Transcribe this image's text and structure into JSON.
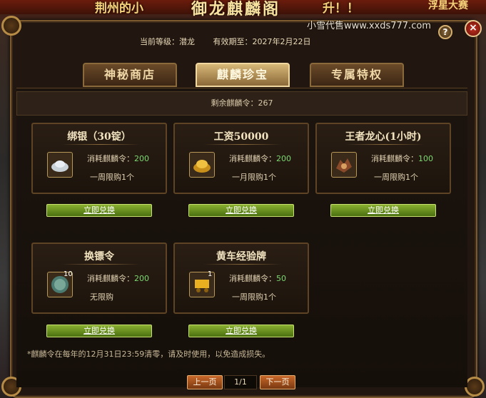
{
  "banner": {
    "left_text": "荆州的小",
    "center_text": "御龙麒麟阁",
    "right_text": "升！！",
    "far_right_text": "浮星大赛"
  },
  "watermark": "小雪代售www.xxds777.com",
  "controls": {
    "help_label": "?",
    "close_label": "×"
  },
  "header": {
    "level_label": "当前等级：潜龙",
    "expiry_label": "有效期至：2027年2月22日"
  },
  "tabs": [
    {
      "label": "神秘商店",
      "active": false
    },
    {
      "label": "麒麟珍宝",
      "active": true
    },
    {
      "label": "专属特权",
      "active": false
    }
  ],
  "remaining": "剩余麒麟令：267",
  "items": [
    {
      "title": "绑银（30锭）",
      "icon": "silver-ingot-icon",
      "cost_label": "消耗麒麟令：",
      "cost": "200",
      "limit": "一周限购1个",
      "count": "",
      "button": "立即兑换"
    },
    {
      "title": "工资50000",
      "icon": "gold-ingot-icon",
      "cost_label": "消耗麒麟令：",
      "cost": "200",
      "limit": "一月限购1个",
      "count": "",
      "button": "立即兑换"
    },
    {
      "title": "王者龙心(1小时)",
      "icon": "dragon-heart-icon",
      "cost_label": "消耗麒麟令：",
      "cost": "100",
      "limit": "一周限购1个",
      "count": "",
      "button": "立即兑换"
    },
    {
      "title": "换镖令",
      "icon": "escort-token-icon",
      "cost_label": "消耗麒麟令：",
      "cost": "200",
      "limit": "无限购",
      "count": "10",
      "button": "立即兑换"
    },
    {
      "title": "黄车经验牌",
      "icon": "yellow-cart-icon",
      "cost_label": "消耗麒麟令：",
      "cost": "50",
      "limit": "一周限购1个",
      "count": "1",
      "button": "立即兑换"
    }
  ],
  "note": "*麒麟令在每年的12月31日23:59清零，请及时使用，以免造成损失。",
  "pagination": {
    "prev": "上一页",
    "page": "1/1",
    "next": "下一页"
  }
}
